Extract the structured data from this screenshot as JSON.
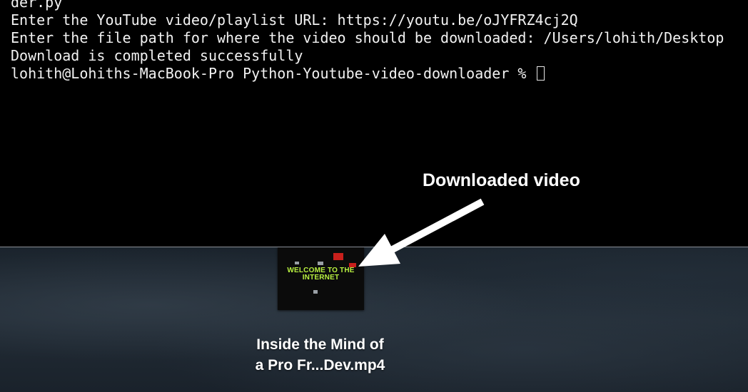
{
  "terminal": {
    "lines": [
      "der.py",
      "Enter the YouTube video/playlist URL: https://youtu.be/oJYFRZ4cj2Q",
      "Enter the file path for where the video should be downloaded: /Users/lohith/Desktop",
      "Download is completed successfully"
    ],
    "prompt": "lohith@Lohiths-MacBook-Pro Python-Youtube-video-downloader % "
  },
  "desktop": {
    "file": {
      "thumbnail_text": "WELCOME TO THE INTERNET",
      "name_line1": "Inside the Mind of",
      "name_line2": "a Pro Fr...Dev.mp4"
    }
  },
  "annotation": {
    "label": "Downloaded video"
  },
  "colors": {
    "terminal_bg": "#000000",
    "terminal_text": "#f2f2f2",
    "thumbnail_accent": "#b8f040",
    "annotation": "#ffffff"
  }
}
